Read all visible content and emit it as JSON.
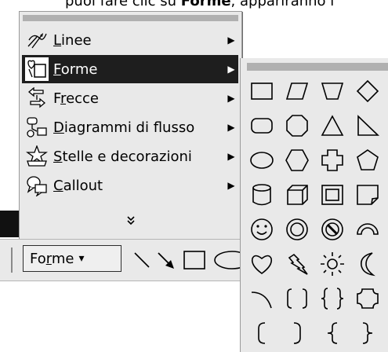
{
  "top_text": {
    "normal": "puoi fare clic su ",
    "bold": "Forme",
    "rest": ", appariranno i"
  },
  "menu": {
    "items": [
      {
        "name": "menu-item-linee",
        "underline": "L",
        "rest": "inee",
        "icon": "lines-icon",
        "has_submenu": true,
        "selected": false
      },
      {
        "name": "menu-item-forme",
        "underline": "F",
        "rest": "orme",
        "icon": "basic-shapes-icon",
        "has_submenu": true,
        "selected": true
      },
      {
        "name": "menu-item-frecce",
        "prefix": "F",
        "underline": "r",
        "rest": "ecce",
        "icon": "block-arrows-icon",
        "has_submenu": true,
        "selected": false
      },
      {
        "name": "menu-item-diagrammi",
        "underline": "D",
        "rest": "iagrammi di flusso",
        "icon": "flowchart-icon",
        "has_submenu": true,
        "selected": false
      },
      {
        "name": "menu-item-stelle",
        "underline": "S",
        "rest": "telle e decorazioni",
        "icon": "stars-banners-icon",
        "has_submenu": true,
        "selected": false
      },
      {
        "name": "menu-item-callout",
        "underline": "C",
        "rest": "allout",
        "icon": "callout-icon",
        "has_submenu": true,
        "selected": false
      }
    ],
    "expand_glyph": "⌄"
  },
  "toolbar": {
    "shapes_button": {
      "prefix": "Fo",
      "underline": "r",
      "rest": "me",
      "arrow": "▾"
    },
    "tools": [
      "line-tool",
      "arrow-tool",
      "rectangle-tool",
      "oval-tool"
    ]
  },
  "submenu": {
    "columns": 4,
    "shapes": [
      "rectangle",
      "parallelogram",
      "trapezoid",
      "diamond",
      "rounded-rectangle",
      "octagon",
      "triangle",
      "right-triangle",
      "oval",
      "hexagon",
      "cross",
      "pentagon",
      "can",
      "cube",
      "bevel",
      "folded-corner",
      "smiley",
      "donut",
      "no-symbol",
      "block-arc",
      "heart",
      "lightning-bolt",
      "sun",
      "moon",
      "arc",
      "double-bracket",
      "double-brace",
      "plaque",
      "left-bracket",
      "right-bracket",
      "left-brace",
      "right-brace"
    ]
  }
}
